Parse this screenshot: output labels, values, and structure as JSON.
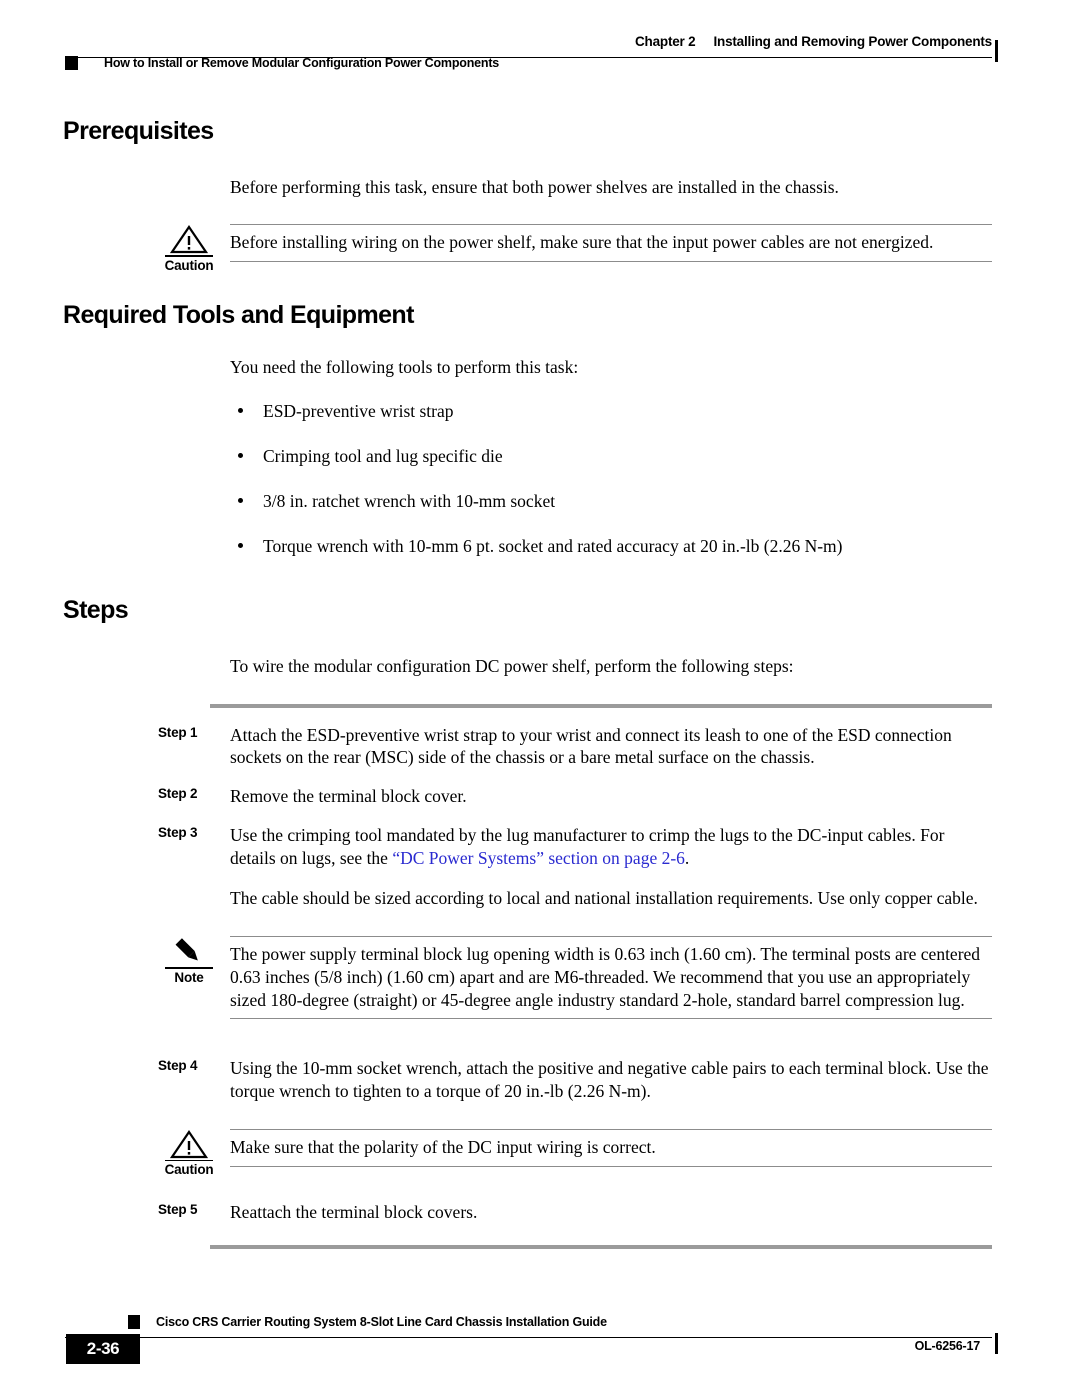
{
  "header": {
    "chapter_number": "Chapter 2",
    "chapter_title": "Installing and Removing Power Components",
    "running_head": "How to Install or Remove Modular Configuration Power Components"
  },
  "sections": {
    "prerequisites": {
      "heading": "Prerequisites",
      "intro": "Before performing this task, ensure that both power shelves are installed in the chassis.",
      "caution": {
        "label": "Caution",
        "text": "Before installing wiring on the power shelf, make sure that the input power cables are not energized."
      }
    },
    "tools": {
      "heading": "Required Tools and Equipment",
      "intro": "You need the following tools to perform this task:",
      "items": [
        "ESD-preventive wrist strap",
        "Crimping tool and lug specific die",
        "3/8 in. ratchet wrench with 10-mm socket",
        "Torque wrench with 10-mm 6 pt. socket and rated accuracy at 20 in.-lb (2.26 N-m)"
      ]
    },
    "steps": {
      "heading": "Steps",
      "intro": "To wire the modular configuration DC power shelf, perform the following steps:",
      "items": [
        {
          "label": "Step 1",
          "text": "Attach the ESD-preventive wrist strap to your wrist and connect its leash to one of the ESD connection sockets on the rear (MSC) side of the chassis or a bare metal surface on the chassis."
        },
        {
          "label": "Step 2",
          "text": "Remove the terminal block cover."
        },
        {
          "label": "Step 3",
          "text_before": "Use the crimping tool mandated by the lug manufacturer to crimp the lugs to the DC-input cables. For details on lugs, see the ",
          "link_text": "“DC Power Systems” section on page 2-6",
          "text_after": ".",
          "subparagraph": "The cable should be sized according to local and national installation requirements. Use only copper cable."
        },
        {
          "label": "Step 4",
          "text": "Using the 10-mm socket wrench, attach the positive and negative cable pairs to each terminal block. Use the torque wrench to tighten to a torque of 20 in.-lb (2.26 N-m)."
        },
        {
          "label": "Step 5",
          "text": "Reattach the terminal block covers."
        }
      ],
      "note": {
        "label": "Note",
        "text": "The power supply terminal block lug opening width is 0.63 inch (1.60 cm). The terminal posts are centered 0.63 inches (5/8 inch) (1.60 cm) apart and are M6-threaded. We recommend that you use an appropriately sized 180-degree (straight) or 45-degree angle industry standard 2-hole, standard barrel compression lug."
      },
      "caution": {
        "label": "Caution",
        "text": "Make sure that the polarity of the DC input wiring is correct."
      }
    }
  },
  "footer": {
    "page_number": "2-36",
    "document_title": "Cisco CRS Carrier Routing System 8-Slot Line Card Chassis Installation Guide",
    "document_id": "OL-6256-17"
  },
  "colors": {
    "text": "#000000",
    "link": "#2a2ad0",
    "rule_gray": "#8c8c8c",
    "steps_rule_gray": "#9b9b9b"
  }
}
